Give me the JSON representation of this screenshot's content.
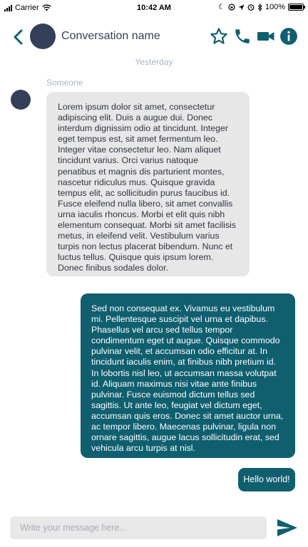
{
  "status_bar": {
    "carrier": "Carrier",
    "time": "10:42 AM",
    "battery": "100%",
    "battery_level": 1.0,
    "icons": [
      "signal-icon",
      "wifi-icon",
      "moon-icon",
      "lock-rotation-icon",
      "location-icon",
      "alarm-icon",
      "bluetooth-icon",
      "battery-icon"
    ]
  },
  "header": {
    "conversation_name": "Conversation name",
    "icons": [
      "back-icon",
      "star-icon",
      "phone-icon",
      "video-icon",
      "info-icon"
    ],
    "accent_color": "#0f5f6f"
  },
  "messages": {
    "day_separator": "Yesterday",
    "incoming": {
      "sender": "Someone",
      "text": "Lorem ipsum dolor sit amet, consectetur adipiscing elit. Duis a augue dui. Donec interdum dignissim odio at tincidunt. Integer eget tempus est, sit amet fermentum leo. Integer vitae consectetur leo. Nam aliquet tincidunt varius. Orci varius natoque penatibus et magnis dis parturient montes, nascetur ridiculus mus. Quisque gravida tempus elit, ac sollicitudin purus faucibus id. Fusce eleifend nulla libero, sit amet convallis urna iaculis rhoncus. Morbi et elit quis nibh elementum consequat. Morbi sit amet facilisis metus, in eleifend velit. Vestibulum varius turpis non lectus placerat bibendum. Nunc et luctus tellus. Quisque quis ipsum lorem. Donec finibus sodales dolor."
    },
    "outgoing": [
      {
        "text": "Sed non consequat ex. Vivamus eu vestibulum mi. Pellentesque suscipit vel urna et dapibus. Phasellus vel arcu sed tellus tempor condimentum eget ut augue. Quisque commodo pulvinar velit, et accumsan odio efficitur at. In tincidunt iaculis enim, at finibus nibh pretium id. In lobortis nisl leo, ut accumsan massa volutpat id. Aliquam maximus nisi vitae ante finibus pulvinar. Fusce euismod dictum tellus sed sagittis. Ut ante leo, feugiat vel dictum eget, accumsan quis eros. Donec sit amet auctor urna, ac tempor libero. Maecenas pulvinar, ligula non ornare sagittis, augue lacus sollicitudin erat, sed vehicula arcu turpis at nisl."
      },
      {
        "text": "Hello world!"
      }
    ],
    "incoming_bubble_color": "#e7e7e8",
    "outgoing_bubble_color": "#0f5f6f"
  },
  "composer": {
    "placeholder": "Write your message here...",
    "value": "",
    "send_icon": "send-icon"
  }
}
